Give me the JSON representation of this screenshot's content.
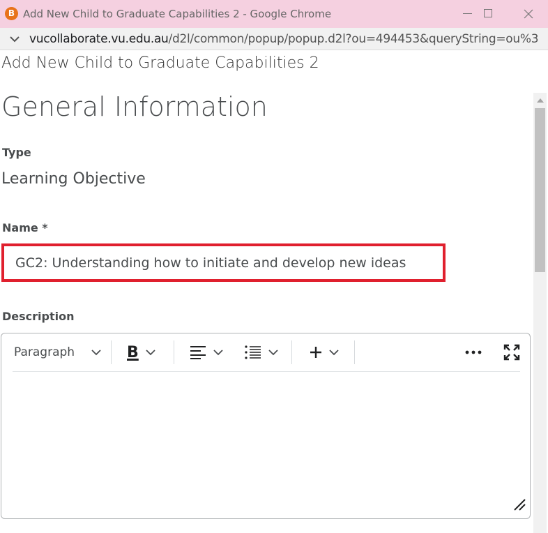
{
  "window": {
    "title": "Add New Child to Graduate Capabilities 2 - Google Chrome",
    "app_icon_letter": "B"
  },
  "address": {
    "url_host": "vucollaborate.vu.edu.au",
    "url_rest": "/d2l/common/popup/popup.d2l?ou=494453&queryString=ou%3D4..."
  },
  "page": {
    "dialog_title": "Add New Child to Graduate Capabilities 2",
    "section_heading": "General Information",
    "type_label": "Type",
    "type_value": "Learning Objective",
    "name_label": "Name *",
    "name_value": "GC2: Understanding how to initiate and develop new ideas",
    "description_label": "Description"
  },
  "editor": {
    "format_label": "Paragraph",
    "bold_label": "B"
  },
  "colors": {
    "highlight": "#e0202e",
    "titlebar": "#f5d0e0"
  }
}
